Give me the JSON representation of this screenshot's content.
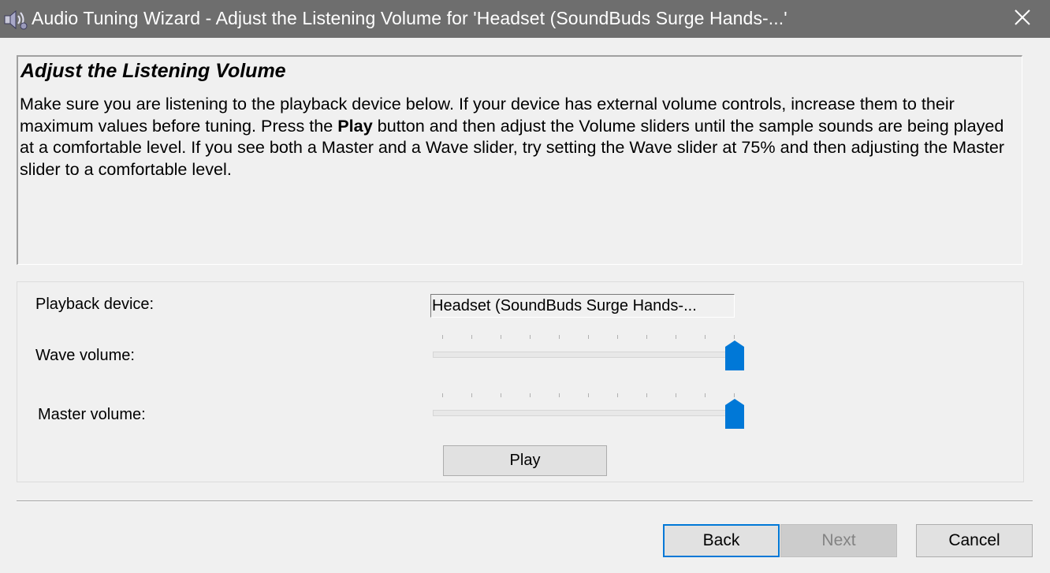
{
  "window": {
    "title": "Audio Tuning Wizard - Adjust the Listening Volume for 'Headset (SoundBuds Surge Hands-...'",
    "icon": "audio-tuning-wizard-icon",
    "close_icon": "close-icon"
  },
  "info": {
    "heading": "Adjust the Listening Volume",
    "body_part1": "Make sure you are listening to the playback device below. If your device has external volume controls, increase them to their maximum values before tuning. Press the ",
    "body_bold": "Play",
    "body_part2": " button and then adjust the Volume sliders until the sample sounds are being played at a comfortable level. If you see both a Master and a Wave slider, try setting the Wave slider at 75% and then adjusting the Master slider to a comfortable level."
  },
  "settings": {
    "playback_device_label": "Playback device:",
    "playback_device_value": "Headset (SoundBuds Surge Hands-...",
    "wave_volume_label": "Wave volume:",
    "wave_volume_level": 1.0,
    "master_volume_label": "Master volume:",
    "master_volume_level": 1.0,
    "play_label": "Play"
  },
  "footer": {
    "back_label": "Back",
    "next_label": "Next",
    "cancel_label": "Cancel",
    "next_enabled": false
  },
  "colors": {
    "titlebar": "#6e6e6e",
    "slider_thumb": "#0078d7",
    "focus_border": "#0078d7"
  }
}
